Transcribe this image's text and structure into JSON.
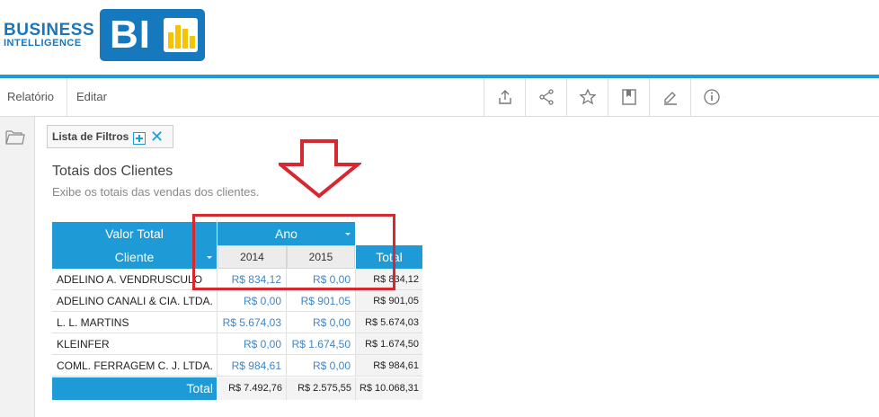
{
  "logo": {
    "line1": "BUSINESS",
    "line2": "INTELLIGENCE",
    "mark": "BI"
  },
  "menu": {
    "report": "Relatório",
    "edit": "Editar"
  },
  "toolbar_icons": [
    "export-icon",
    "share-icon",
    "star-icon",
    "bookmark-icon",
    "edit-pen-icon",
    "info-icon"
  ],
  "filters": {
    "label": "Lista de Filtros"
  },
  "report": {
    "title": "Totais dos Clientes",
    "subtitle": "Exibe os totais das vendas dos clientes."
  },
  "table": {
    "measure_header": "Valor Total",
    "row_header": "Cliente",
    "col_header": "Ano",
    "years": [
      "2014",
      "2015"
    ],
    "total_header": "Total",
    "rows": [
      {
        "client": "ADELINO A. VENDRUSCULO",
        "y2014": "R$ 834,12",
        "y2015": "R$ 0,00",
        "total": "R$ 834,12"
      },
      {
        "client": "ADELINO CANALI & CIA. LTDA.",
        "y2014": "R$ 0,00",
        "y2015": "R$ 901,05",
        "total": "R$ 901,05"
      },
      {
        "client": "L. L. MARTINS",
        "y2014": "R$ 5.674,03",
        "y2015": "R$ 0,00",
        "total": "R$ 5.674,03"
      },
      {
        "client": "KLEINFER",
        "y2014": "R$ 0,00",
        "y2015": "R$ 1.674,50",
        "total": "R$ 1.674,50"
      },
      {
        "client": "COML. FERRAGEM C. J. LTDA.",
        "y2014": "R$ 984,61",
        "y2015": "R$ 0,00",
        "total": "R$ 984,61"
      }
    ],
    "grand_total_label": "Total",
    "grand_totals": {
      "y2014": "R$ 7.492,76",
      "y2015": "R$ 2.575,55",
      "total": "R$ 10.068,31"
    }
  },
  "colors": {
    "accent": "#1e9ad6",
    "annotation": "#d8282f"
  }
}
